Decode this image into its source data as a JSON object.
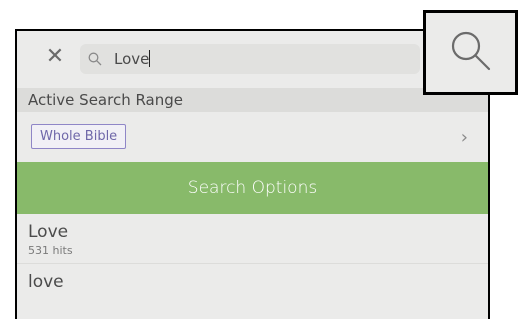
{
  "search": {
    "close_glyph": "✕",
    "query": "Love",
    "placeholder_icon": "search-icon"
  },
  "range": {
    "header": "Active Search Range",
    "value": "Whole Bible",
    "chevron": "›"
  },
  "options": {
    "label": "Search Options"
  },
  "results": [
    {
      "title": "Love",
      "hits": "531 hits"
    },
    {
      "title": "love",
      "hits": ""
    }
  ],
  "colors": {
    "accent_green": "#88ba6a",
    "tag_purple": "#6f67a9"
  }
}
